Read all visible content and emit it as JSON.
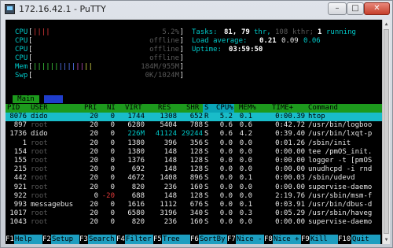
{
  "window": {
    "title": "172.16.42.1 - PuTTY",
    "min_label": "–",
    "max_label": "□",
    "close_label": "✕"
  },
  "meters": {
    "cpu_label": "CPU",
    "cpu1_value": "5.2%",
    "cpu2_value": "offline",
    "cpu3_value": "offline",
    "cpu4_value": "offline",
    "mem_label": "Mem",
    "mem_value": "184M/955M",
    "swp_label": "Swp",
    "swp_value": "0K/1024M",
    "cpu1_bars": "||||",
    "mem_bars": "||||||||||||||"
  },
  "summary": {
    "tasks_label": "Tasks:",
    "tasks_value": "81,",
    "thr_value": "79",
    "thr_label": "thr,",
    "kthr_value": "108",
    "kthr_label": "kthr;",
    "running_value": "1",
    "running_label": "running",
    "load_label": "Load average:",
    "load1": "0.21",
    "load5": "0.09",
    "load15": "0.06",
    "uptime_label": "Uptime:",
    "uptime_value": "03:59:50"
  },
  "tabs": {
    "main": "Main",
    "io": "I/O"
  },
  "columns": {
    "pid": "PID",
    "user": "USER",
    "pri": "PRI",
    "ni": "NI",
    "virt": "VIRT",
    "res": "RES",
    "shr": "SHR",
    "s": "S",
    "cpu": "CPU%",
    "mem": "MEM%",
    "time": "TIME+",
    "command": "Command"
  },
  "processes": [
    {
      "pid": "8076",
      "user": "dido",
      "pri": "20",
      "ni": "0",
      "virt": "1744",
      "res": "1308",
      "shr": "652",
      "s": "R",
      "cpu": "5.2",
      "mem": "0.1",
      "time": "0:00.39",
      "command": "htop"
    },
    {
      "pid": "897",
      "user": "root",
      "pri": "20",
      "ni": "0",
      "virt": "6280",
      "res": "5404",
      "shr": "788",
      "s": "S",
      "cpu": "0.6",
      "mem": "0.6",
      "time": "0:42.72",
      "command": "/usr/bin/logboo"
    },
    {
      "pid": "1736",
      "user": "dido",
      "pri": "20",
      "ni": "0",
      "virt": "226M",
      "res": "41124",
      "shr": "29244",
      "s": "S",
      "cpu": "0.6",
      "mem": "4.2",
      "time": "0:39.40",
      "command": "/usr/bin/lxqt-p"
    },
    {
      "pid": "1",
      "user": "root",
      "pri": "20",
      "ni": "0",
      "virt": "1380",
      "res": "396",
      "shr": "356",
      "s": "S",
      "cpu": "0.0",
      "mem": "0.0",
      "time": "0:01.26",
      "command": "/sbin/init"
    },
    {
      "pid": "154",
      "user": "root",
      "pri": "20",
      "ni": "0",
      "virt": "1380",
      "res": "148",
      "shr": "128",
      "s": "S",
      "cpu": "0.0",
      "mem": "0.0",
      "time": "0:00.00",
      "command": "tee /pmOS_init."
    },
    {
      "pid": "155",
      "user": "root",
      "pri": "20",
      "ni": "0",
      "virt": "1376",
      "res": "148",
      "shr": "128",
      "s": "S",
      "cpu": "0.0",
      "mem": "0.0",
      "time": "0:00.00",
      "command": "logger -t [pmOS"
    },
    {
      "pid": "215",
      "user": "root",
      "pri": "20",
      "ni": "0",
      "virt": "692",
      "res": "148",
      "shr": "128",
      "s": "S",
      "cpu": "0.0",
      "mem": "0.0",
      "time": "0:00.00",
      "command": "unudhcpd -i rnd"
    },
    {
      "pid": "442",
      "user": "root",
      "pri": "20",
      "ni": "0",
      "virt": "4672",
      "res": "1408",
      "shr": "896",
      "s": "S",
      "cpu": "0.0",
      "mem": "0.1",
      "time": "0:00.03",
      "command": "/sbin/udevd"
    },
    {
      "pid": "921",
      "user": "root",
      "pri": "20",
      "ni": "0",
      "virt": "820",
      "res": "236",
      "shr": "160",
      "s": "S",
      "cpu": "0.0",
      "mem": "0.0",
      "time": "0:00.00",
      "command": "supervise-daemo"
    },
    {
      "pid": "922",
      "user": "root",
      "pri": "0",
      "ni": "-20",
      "virt": "688",
      "res": "148",
      "shr": "128",
      "s": "S",
      "cpu": "0.0",
      "mem": "0.0",
      "time": "2:19.76",
      "command": "/usr/sbin/msm-f"
    },
    {
      "pid": "993",
      "user": "messagebus",
      "pri": "20",
      "ni": "0",
      "virt": "1616",
      "res": "1112",
      "shr": "676",
      "s": "S",
      "cpu": "0.0",
      "mem": "0.1",
      "time": "0:03.91",
      "command": "/usr/bin/dbus-d"
    },
    {
      "pid": "1017",
      "user": "root",
      "pri": "20",
      "ni": "0",
      "virt": "6580",
      "res": "3196",
      "shr": "340",
      "s": "S",
      "cpu": "0.0",
      "mem": "0.3",
      "time": "0:05.29",
      "command": "/usr/sbin/haveg"
    },
    {
      "pid": "1043",
      "user": "root",
      "pri": "20",
      "ni": "0",
      "virt": "820",
      "res": "236",
      "shr": "160",
      "s": "S",
      "cpu": "0.0",
      "mem": "0.0",
      "time": "0:00.00",
      "command": "supervise-daemo"
    }
  ],
  "fkeys": [
    {
      "key": "F1",
      "label": "Help"
    },
    {
      "key": "F2",
      "label": "Setup"
    },
    {
      "key": "F3",
      "label": "Search"
    },
    {
      "key": "F4",
      "label": "Filter"
    },
    {
      "key": "F5",
      "label": "Tree"
    },
    {
      "key": "F6",
      "label": "SortBy"
    },
    {
      "key": "F7",
      "label": "Nice -"
    },
    {
      "key": "F8",
      "label": "Nice +"
    },
    {
      "key": "F9",
      "label": "Kill"
    },
    {
      "key": "F10",
      "label": "Quit"
    }
  ]
}
